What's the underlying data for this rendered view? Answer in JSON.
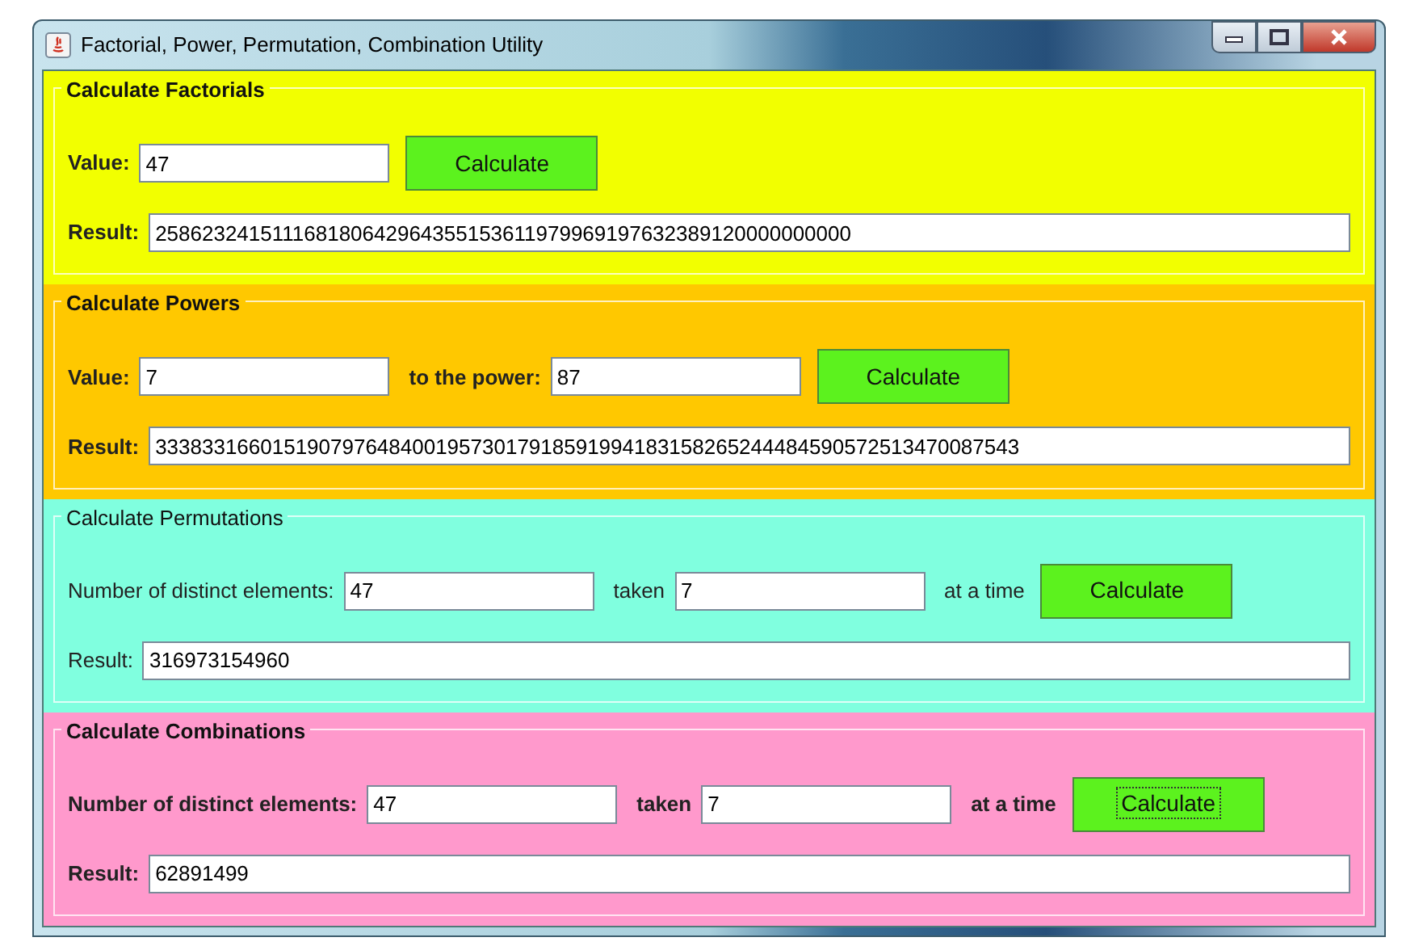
{
  "window": {
    "title": "Factorial, Power, Permutation, Combination Utility"
  },
  "panels": [
    {
      "title": "Calculate Factorials",
      "color": "#f2ff00",
      "bold": true,
      "inputs": [
        {
          "kind": "label",
          "text": "Value:"
        },
        {
          "kind": "field",
          "value": "47"
        },
        {
          "kind": "button",
          "text": "Calculate",
          "focused": false
        }
      ],
      "result": {
        "label": "Result:",
        "value": "258623241511168180642964355153611979969197632389120000000000"
      }
    },
    {
      "title": "Calculate Powers",
      "color": "#ffc800",
      "bold": true,
      "inputs": [
        {
          "kind": "label",
          "text": "Value:"
        },
        {
          "kind": "field",
          "value": "7"
        },
        {
          "kind": "label",
          "text": "to the power:"
        },
        {
          "kind": "field",
          "value": "87"
        },
        {
          "kind": "button",
          "text": "Calculate",
          "focused": false
        }
      ],
      "result": {
        "label": "Result:",
        "value": "33383316601519079764840019573017918591994183158265244484590572513470087543"
      }
    },
    {
      "title": "Calculate Permutations",
      "color": "#80ffdf",
      "bold": false,
      "inputs": [
        {
          "kind": "label",
          "text": "Number of distinct elements:"
        },
        {
          "kind": "field",
          "value": "47"
        },
        {
          "kind": "label",
          "text": "taken"
        },
        {
          "kind": "field",
          "value": "7"
        },
        {
          "kind": "label",
          "text": "at a time"
        },
        {
          "kind": "button",
          "text": "Calculate",
          "focused": false
        }
      ],
      "result": {
        "label": "Result:",
        "value": "316973154960"
      }
    },
    {
      "title": "Calculate Combinations",
      "color": "#ff99cc",
      "bold": true,
      "inputs": [
        {
          "kind": "label",
          "text": "Number of distinct elements:"
        },
        {
          "kind": "field",
          "value": "47"
        },
        {
          "kind": "label",
          "text": "taken"
        },
        {
          "kind": "field",
          "value": "7"
        },
        {
          "kind": "label",
          "text": "at a time"
        },
        {
          "kind": "button",
          "text": "Calculate",
          "focused": true
        }
      ],
      "result": {
        "label": "Result:",
        "value": "62891499"
      }
    }
  ]
}
